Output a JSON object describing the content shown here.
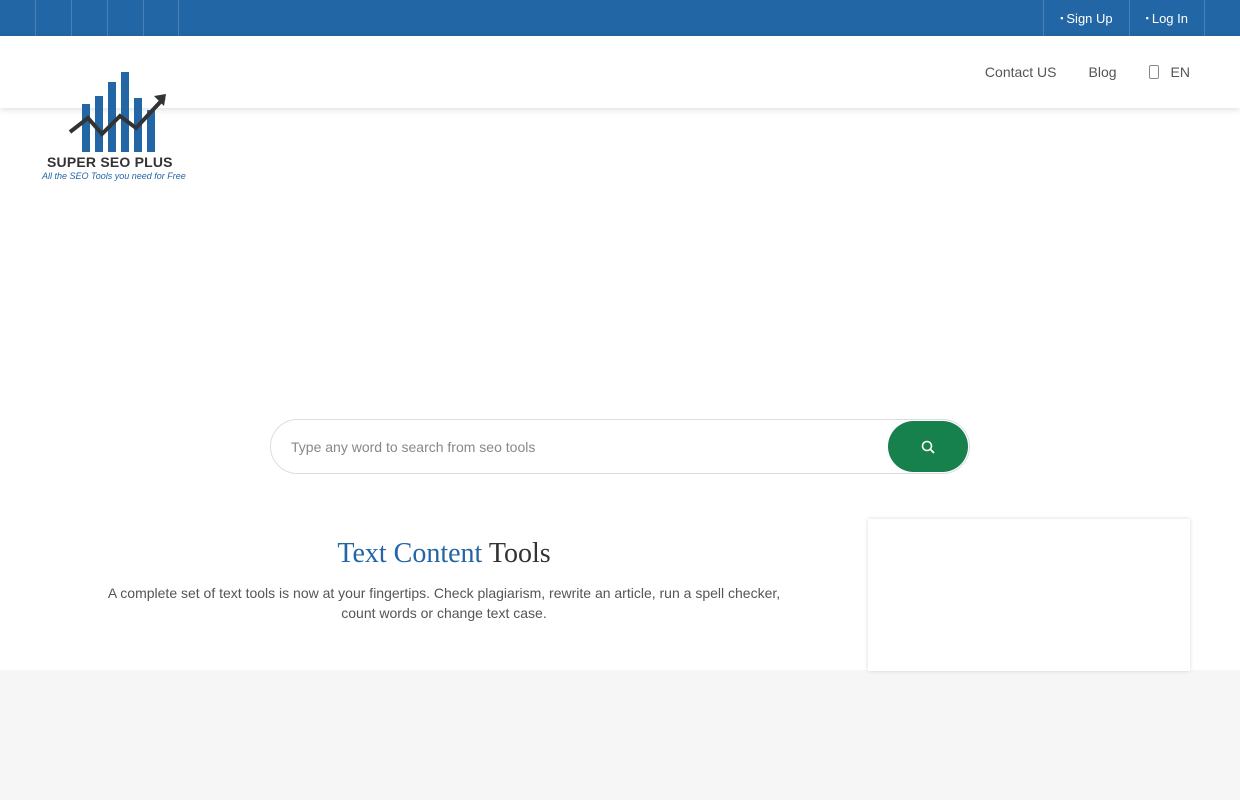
{
  "topbar": {
    "social_icons": [
      "facebook-icon",
      "twitter-icon",
      "linkedin-icon",
      "youtube-icon"
    ],
    "social_glyph": "",
    "signup_label": "Sign Up",
    "login_label": "Log In"
  },
  "nav": {
    "contact_label": "Contact US",
    "blog_label": "Blog",
    "lang_label": "EN"
  },
  "logo": {
    "name": "SUPER SEO PLUS",
    "tagline": "All the SEO Tools you need for Free"
  },
  "search": {
    "placeholder": "Type any word to search from seo tools"
  },
  "section": {
    "title_accent": "Text Content",
    "title_rest": "Tools",
    "description": "A complete set of text tools is now at your fingertips. Check plagiarism, rewrite an article, run a spell checker, count words or change text case."
  },
  "colors": {
    "primary": "#2366a5",
    "accent_green": "#17814d",
    "text": "#555555"
  }
}
